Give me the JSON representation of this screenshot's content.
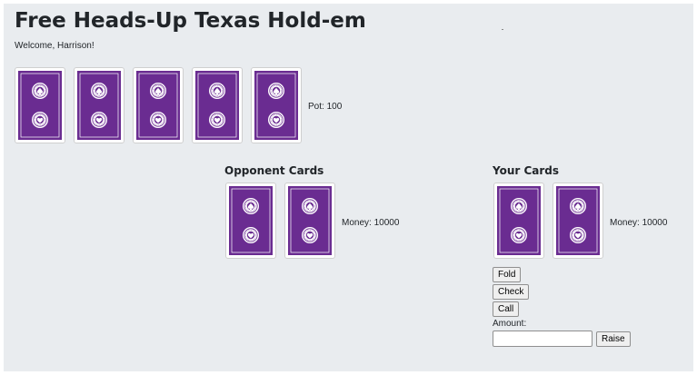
{
  "header": {
    "title": "Free Heads-Up Texas Hold-em",
    "welcome": "Welcome, Harrison!"
  },
  "board": {
    "cards": [
      {
        "face": "back"
      },
      {
        "face": "back"
      },
      {
        "face": "back"
      },
      {
        "face": "back"
      },
      {
        "face": "back"
      }
    ],
    "pot_label": "Pot: 100"
  },
  "opponent": {
    "heading": "Opponent Cards",
    "cards": [
      {
        "face": "back"
      },
      {
        "face": "back"
      }
    ],
    "money_label": "Money: 10000"
  },
  "player": {
    "heading": "Your Cards",
    "cards": [
      {
        "face": "back"
      },
      {
        "face": "back"
      }
    ],
    "money_label": "Money: 10000"
  },
  "actions": {
    "fold_label": "Fold",
    "check_label": "Check",
    "call_label": "Call",
    "amount_label": "Amount:",
    "amount_value": "",
    "raise_label": "Raise"
  },
  "colors": {
    "card_back": "#6a2c91",
    "card_border": "#cfcfcf",
    "page_bg": "#e9ecef"
  }
}
